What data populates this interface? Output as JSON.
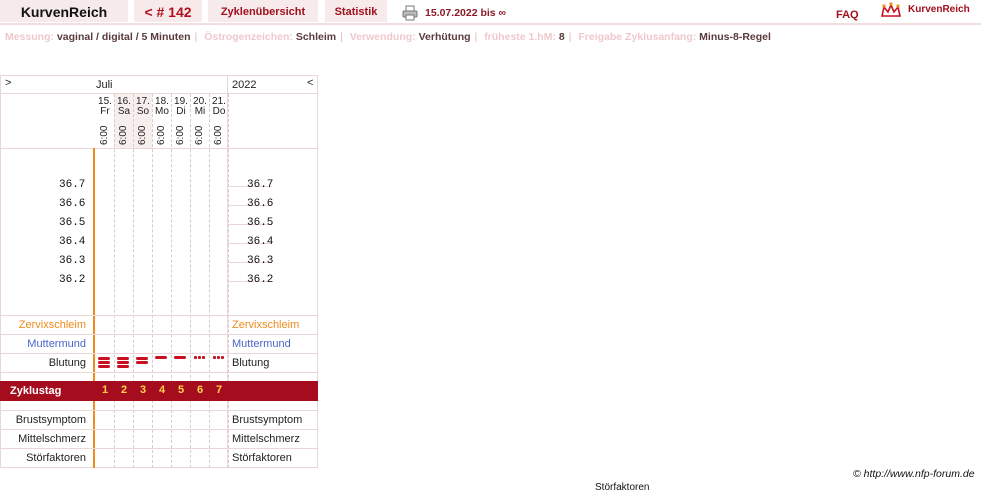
{
  "header": {
    "brand": "KurvenReich",
    "cycle_number": "< # 142",
    "tab_overview": "Zyklenübersicht",
    "tab_statistics": "Statistik",
    "print_icon": "printer-icon",
    "date_range": "15.07.2022 bis ∞",
    "faq": "FAQ",
    "logo_text": "KurvenReich",
    "logo_icon": "crown-icon"
  },
  "settings": [
    {
      "key": "Messung:",
      "value": "vaginal / digital / 5 Minuten"
    },
    {
      "key": "Östrogenzeichen:",
      "value": "Schleim"
    },
    {
      "key": "Verwendung:",
      "value": "Verhütung"
    },
    {
      "key": "früheste 1.hM:",
      "value": "8"
    },
    {
      "key": "Freigabe Zyklusanfang:",
      "value": "Minus-8-Regel"
    }
  ],
  "chart": {
    "nav_prev": ">",
    "nav_next": "<",
    "month": "Juli",
    "year": "2022",
    "days": [
      {
        "date": "15.",
        "weekday": "Fr",
        "time": "6:00"
      },
      {
        "date": "16.",
        "weekday": "Sa",
        "time": "6:00"
      },
      {
        "date": "17.",
        "weekday": "So",
        "time": "6:00"
      },
      {
        "date": "18.",
        "weekday": "Mo",
        "time": "6:00"
      },
      {
        "date": "19.",
        "weekday": "Di",
        "time": "6:00"
      },
      {
        "date": "20.",
        "weekday": "Mi",
        "time": "6:00"
      },
      {
        "date": "21.",
        "weekday": "Do",
        "time": "6:00"
      }
    ],
    "temp_left": [
      "36.7",
      "36.6",
      "36.5",
      "36.4",
      "36.3",
      "36.2"
    ],
    "temp_right": [
      "36.7",
      "36.6",
      "36.5",
      "36.4",
      "36.3",
      "36.2"
    ],
    "rows": {
      "cervical_fluid": "Zervixschleim",
      "cervix": "Muttermund",
      "bleeding": "Blutung",
      "cycle_day": "Zyklustag",
      "breast": "Brustsymptom",
      "mittelschmerz": "Mittelschmerz",
      "disturbances": "Störfaktoren"
    },
    "cycle_days": [
      "1",
      "2",
      "3",
      "4",
      "5",
      "6",
      "7"
    ],
    "bleeding_intensity": [
      "heavy",
      "heavy",
      "medium",
      "light",
      "light",
      "spotting",
      "spotting"
    ],
    "colors": {
      "accent": "#a50d1e",
      "orange": "#f08b1c",
      "blue": "#4a64c8",
      "cycle_day_text": "#ffd24a"
    }
  },
  "footer": {
    "copyright": "© http://www.nfp-forum.de",
    "cut_text": "Störfaktoren"
  }
}
